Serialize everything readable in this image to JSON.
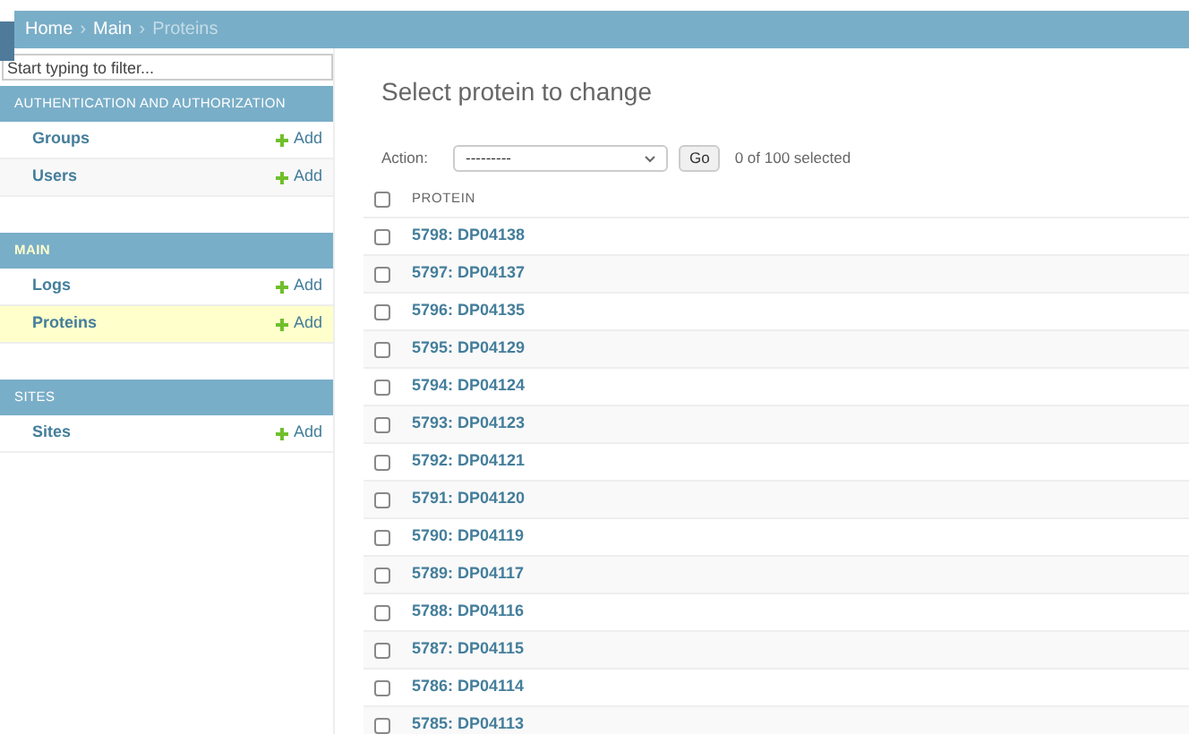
{
  "breadcrumbs": [
    {
      "label": "Home",
      "current": false
    },
    {
      "label": "Main",
      "current": false
    },
    {
      "label": "Proteins",
      "current": true
    }
  ],
  "breadcrumb_separator": "›",
  "sidebar": {
    "filter_placeholder": "Start typing to filter...",
    "groups": [
      {
        "title": "AUTHENTICATION AND AUTHORIZATION",
        "items": [
          {
            "label": "Groups",
            "add": "Add",
            "selected": false
          },
          {
            "label": "Users",
            "add": "Add",
            "selected": false
          }
        ]
      },
      {
        "title": "MAIN",
        "items": [
          {
            "label": "Logs",
            "add": "Add",
            "selected": false
          },
          {
            "label": "Proteins",
            "add": "Add",
            "selected": true
          }
        ]
      },
      {
        "title": "SITES",
        "items": [
          {
            "label": "Sites",
            "add": "Add",
            "selected": false
          }
        ]
      }
    ]
  },
  "content": {
    "title": "Select protein to change",
    "action_label": "Action:",
    "action_value": "---------",
    "go_button": "Go",
    "selection_count": "0 of 100 selected",
    "table": {
      "columns": [
        "PROTEIN"
      ],
      "header_checked": false,
      "rows": [
        {
          "label": "5798: DP04138",
          "checked": false
        },
        {
          "label": "5797: DP04137",
          "checked": false
        },
        {
          "label": "5796: DP04135",
          "checked": false
        },
        {
          "label": "5795: DP04129",
          "checked": false
        },
        {
          "label": "5794: DP04124",
          "checked": false
        },
        {
          "label": "5793: DP04123",
          "checked": false
        },
        {
          "label": "5792: DP04121",
          "checked": false
        },
        {
          "label": "5791: DP04120",
          "checked": false
        },
        {
          "label": "5790: DP04119",
          "checked": false
        },
        {
          "label": "5789: DP04117",
          "checked": false
        },
        {
          "label": "5788: DP04116",
          "checked": false
        },
        {
          "label": "5787: DP04115",
          "checked": false
        },
        {
          "label": "5786: DP04114",
          "checked": false
        },
        {
          "label": "5785: DP04113",
          "checked": false
        }
      ]
    }
  }
}
